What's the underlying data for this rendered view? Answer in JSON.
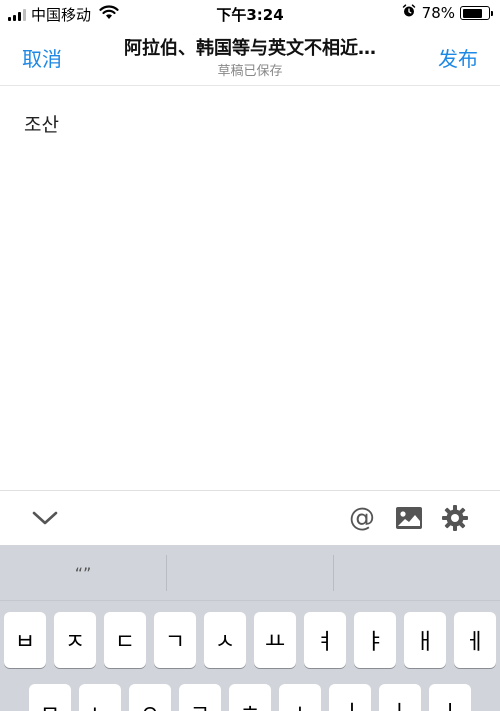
{
  "status_bar": {
    "carrier": "中国移动",
    "time": "下午3:24",
    "battery_percent": "78%",
    "battery_level": 0.78
  },
  "nav": {
    "cancel_label": "取消",
    "title": "阿拉伯、韩国等与英文不相近…",
    "subtitle": "草稿已保存",
    "publish_label": "发布"
  },
  "editor": {
    "content": "조산"
  },
  "toolbar": {
    "at_label": "@",
    "icons": [
      "chevron-down-icon",
      "image-icon",
      "gear-icon"
    ]
  },
  "predictive": {
    "suggestions": [
      "“”",
      "",
      ""
    ]
  },
  "keyboard": {
    "row1": [
      "ㅂ",
      "ㅈ",
      "ㄷ",
      "ㄱ",
      "ㅅ",
      "ㅛ",
      "ㅕ",
      "ㅑ",
      "ㅐ",
      "ㅔ"
    ],
    "row2": [
      "ㅁ",
      "ㄴ",
      "ㅇ",
      "ㄹ",
      "ㅎ",
      "ㅗ",
      "ㅓ",
      "ㅏ",
      "ㅣ"
    ]
  },
  "colors": {
    "accent": "#1e88e5",
    "keyboard_bg": "#d1d5db"
  }
}
